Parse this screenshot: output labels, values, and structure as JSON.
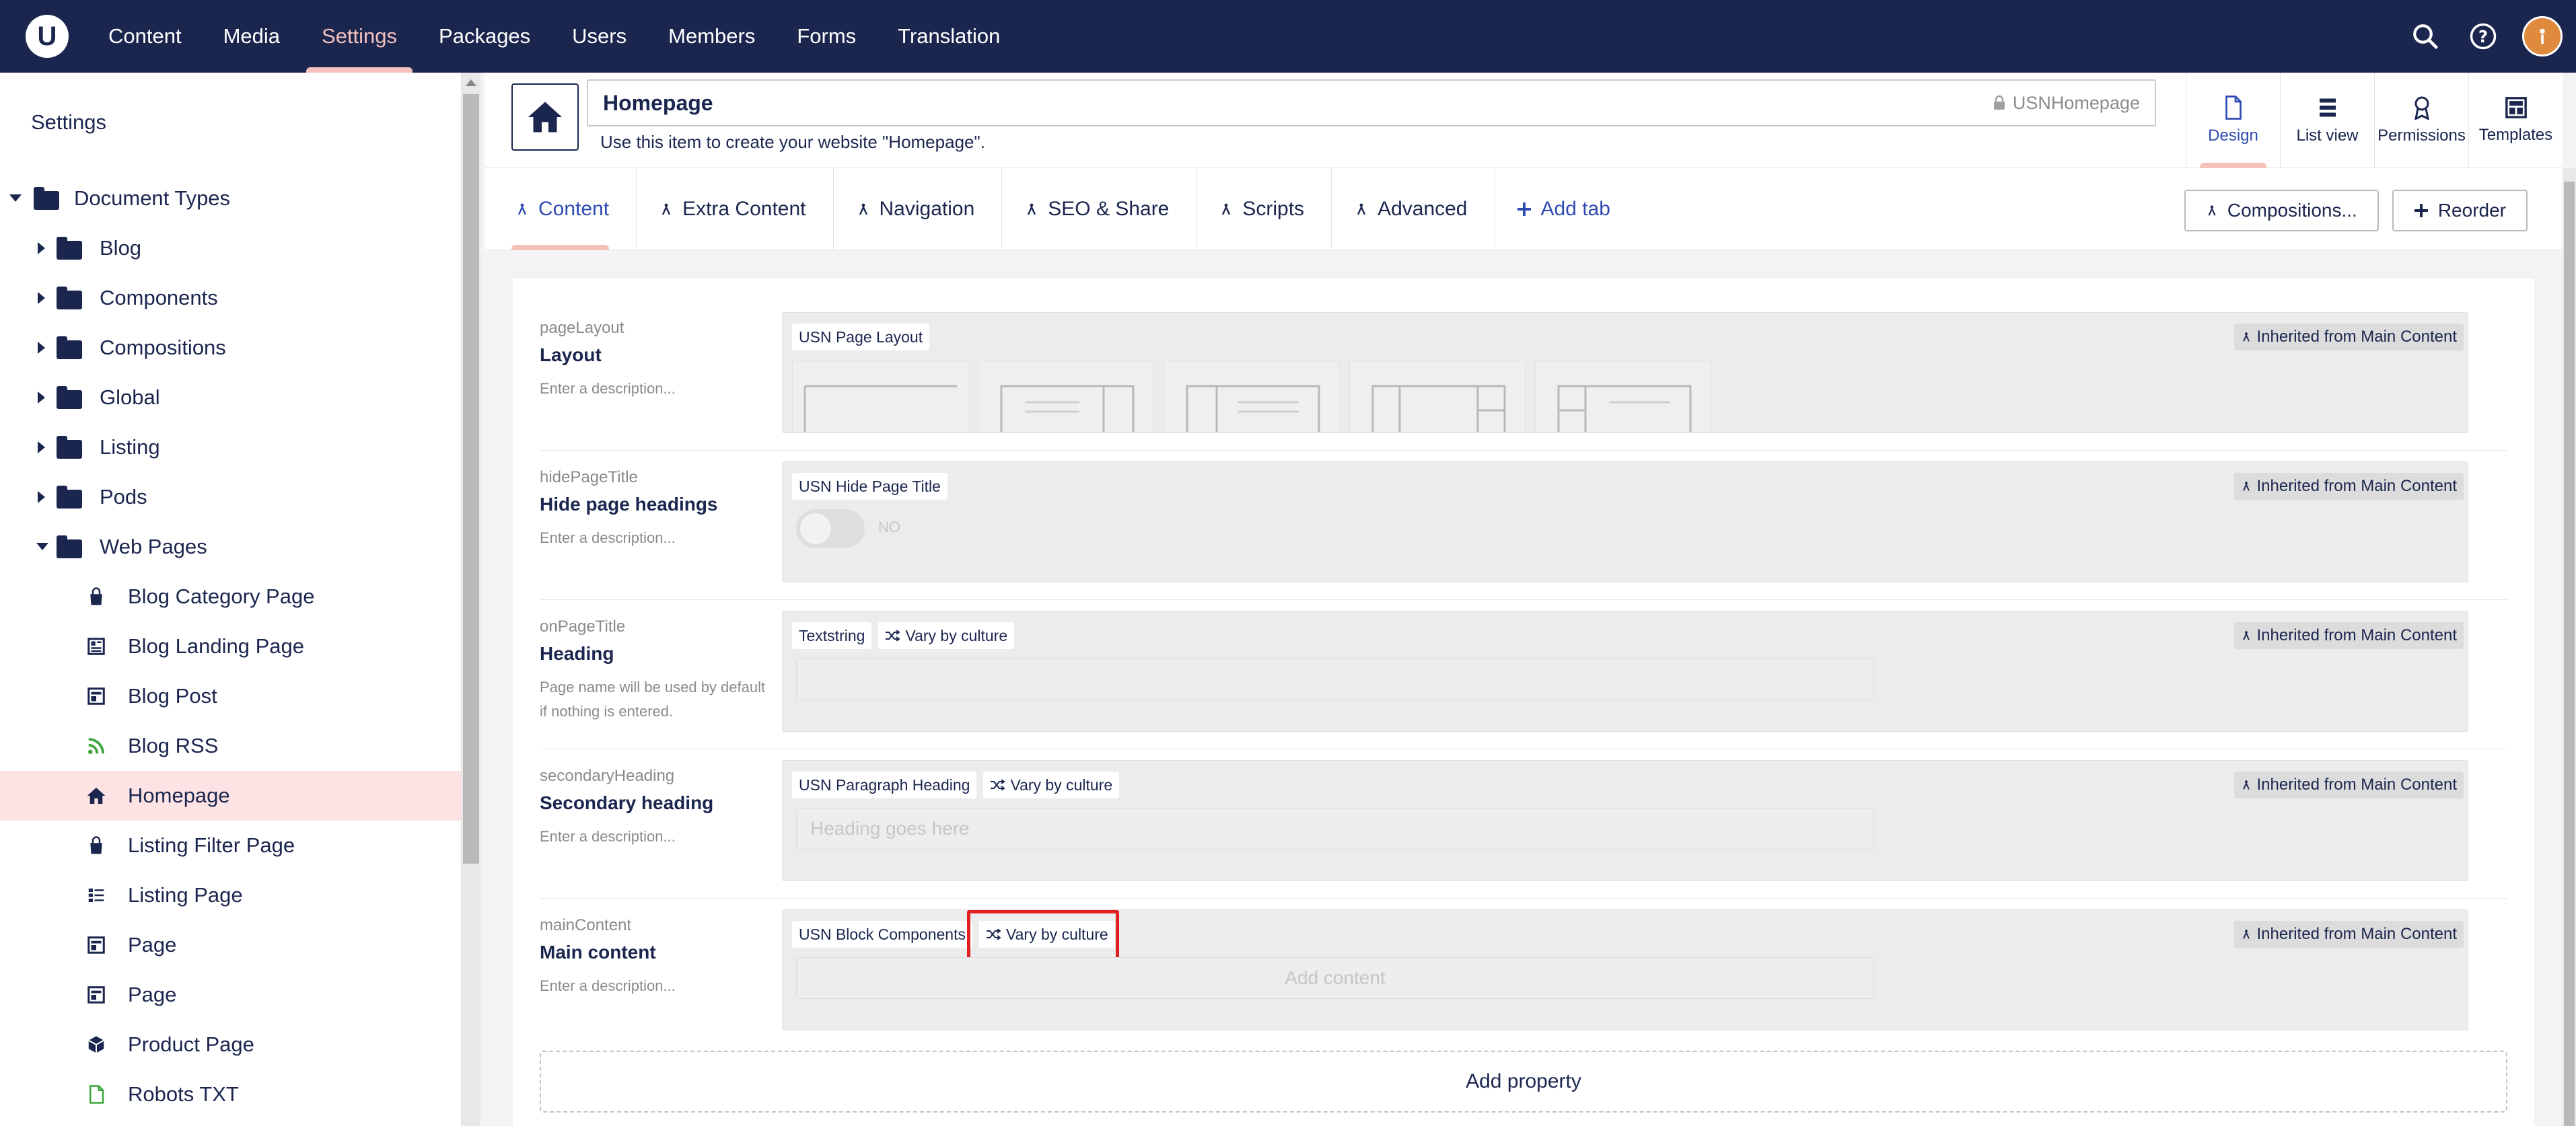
{
  "topbar": {
    "logo": "U",
    "nav": [
      {
        "label": "Content"
      },
      {
        "label": "Media"
      },
      {
        "label": "Settings"
      },
      {
        "label": "Packages"
      },
      {
        "label": "Users"
      },
      {
        "label": "Members"
      },
      {
        "label": "Forms"
      },
      {
        "label": "Translation"
      }
    ],
    "active_nav": "Settings",
    "icons": [
      "search-icon",
      "help-icon",
      "user-avatar"
    ]
  },
  "sidebar": {
    "title": "Settings",
    "tree": [
      {
        "label": "Document Types",
        "icon": "folder-icon",
        "caret": "down"
      },
      {
        "label": "Blog",
        "icon": "folder-icon",
        "caret": "right"
      },
      {
        "label": "Components",
        "icon": "folder-icon",
        "caret": "right"
      },
      {
        "label": "Compositions",
        "icon": "folder-icon",
        "caret": "right"
      },
      {
        "label": "Global",
        "icon": "folder-icon",
        "caret": "right"
      },
      {
        "label": "Listing",
        "icon": "folder-icon",
        "caret": "right"
      },
      {
        "label": "Pods",
        "icon": "folder-icon",
        "caret": "right"
      },
      {
        "label": "Web Pages",
        "icon": "folder-icon",
        "caret": "down"
      },
      {
        "label": "Blog Category Page",
        "icon": "bag-icon"
      },
      {
        "label": "Blog Landing Page",
        "icon": "newspaper-icon"
      },
      {
        "label": "Blog Post",
        "icon": "layout-icon"
      },
      {
        "label": "Blog RSS",
        "icon": "rss-icon"
      },
      {
        "label": "Homepage",
        "icon": "home-icon",
        "selected": true
      },
      {
        "label": "Listing Filter Page",
        "icon": "bag-icon"
      },
      {
        "label": "Listing Page",
        "icon": "list-icon"
      },
      {
        "label": "Page",
        "icon": "layout-icon"
      },
      {
        "label": "Page",
        "icon": "layout-icon"
      },
      {
        "label": "Product Page",
        "icon": "box-icon"
      },
      {
        "label": "Robots TXT",
        "icon": "file-icon"
      }
    ]
  },
  "editor": {
    "name": "Homepage",
    "alias": "USNHomepage",
    "description": "Use this item to create your website \"Homepage\".",
    "apps": [
      {
        "label": "Design",
        "icon": "document-icon"
      },
      {
        "label": "List view",
        "icon": "list-view-icon"
      },
      {
        "label": "Permissions",
        "icon": "permissions-icon"
      },
      {
        "label": "Templates",
        "icon": "templates-icon"
      }
    ]
  },
  "tabs": {
    "items": [
      {
        "label": "Content"
      },
      {
        "label": "Extra Content"
      },
      {
        "label": "Navigation"
      },
      {
        "label": "SEO & Share"
      },
      {
        "label": "Scripts"
      },
      {
        "label": "Advanced"
      }
    ],
    "add_tab": "Add tab",
    "compositions_button": "Compositions...",
    "reorder_button": "Reorder"
  },
  "properties": [
    {
      "alias": "pageLayout",
      "name": "Layout",
      "description": "Enter a description...",
      "editor": "USN Page Layout",
      "vary": "",
      "inherited": "Inherited from Main Content"
    },
    {
      "alias": "hidePageTitle",
      "name": "Hide page headings",
      "description": "Enter a description...",
      "editor": "USN Hide Page Title",
      "vary": "",
      "inherited": "Inherited from Main Content",
      "toggle_label": "NO"
    },
    {
      "alias": "onPageTitle",
      "name": "Heading",
      "description": "Page name will be used by default if nothing is entered.",
      "editor": "Textstring",
      "vary": "Vary by culture",
      "inherited": "Inherited from Main Content"
    },
    {
      "alias": "secondaryHeading",
      "name": "Secondary heading",
      "description": "Enter a description...",
      "editor": "USN Paragraph Heading",
      "vary": "Vary by culture",
      "inherited": "Inherited from Main Content",
      "placeholder": "Heading goes here"
    },
    {
      "alias": "mainContent",
      "name": "Main content",
      "description": "Enter a description...",
      "editor": "USN Block Components",
      "vary": "Vary by culture",
      "inherited": "Inherited from Main Content",
      "button": "Add content"
    }
  ],
  "add_property": "Add property",
  "colors": {
    "header": "#1b264f",
    "accent": "#f5c1bc",
    "selected_row": "#fde3e3",
    "highlight": "#e02020",
    "link_blue": "#2f4bb1"
  }
}
